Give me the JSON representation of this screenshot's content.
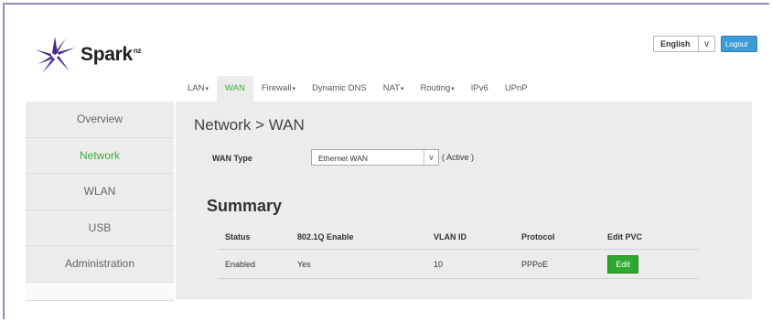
{
  "brand": {
    "name": "Spark",
    "superscript": "nz"
  },
  "header": {
    "language": "English",
    "logout_label": "Logout"
  },
  "topnav": [
    {
      "label": "LAN",
      "dropdown": true
    },
    {
      "label": "WAN",
      "dropdown": false,
      "active": true
    },
    {
      "label": "Firewall",
      "dropdown": true
    },
    {
      "label": "Dynamic DNS",
      "dropdown": false
    },
    {
      "label": "NAT",
      "dropdown": true
    },
    {
      "label": "Routing",
      "dropdown": true
    },
    {
      "label": "IPv6",
      "dropdown": false
    },
    {
      "label": "UPnP",
      "dropdown": false
    }
  ],
  "sidebar": [
    {
      "label": "Overview"
    },
    {
      "label": "Network",
      "active": true
    },
    {
      "label": "WLAN"
    },
    {
      "label": "USB"
    },
    {
      "label": "Administration"
    }
  ],
  "main": {
    "title": "Network > WAN",
    "wan_type_label": "WAN Type",
    "wan_type_value": "Ethernet WAN",
    "wan_status": "( Active )",
    "summary_title": "Summary"
  },
  "table": {
    "headers": [
      "Status",
      "802.1Q Enable",
      "VLAN ID",
      "Protocol",
      "Edit PVC"
    ],
    "rows": [
      {
        "status": "Enabled",
        "enable_8021q": "Yes",
        "vlan_id": "10",
        "protocol": "PPPoE",
        "edit_label": "Edit"
      }
    ]
  },
  "colors": {
    "accent_green": "#3cae3c",
    "edit_button": "#2fa82f",
    "logout_blue": "#3d9bd6"
  },
  "icons": {
    "dropdown": "chevron-down-icon",
    "tab_dropdown": "caret-down-icon"
  }
}
